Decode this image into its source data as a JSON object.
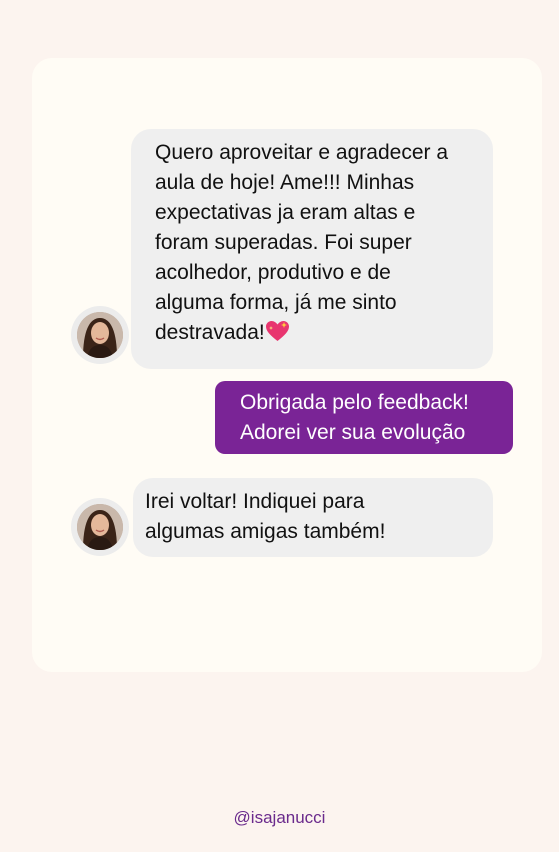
{
  "messages": [
    {
      "sender": "contact",
      "text": "Quero aproveitar e agradecer a\naula de hoje! Ame!!! Minhas\nexpectativas ja eram altas e\nforam superadas. Foi super\nacolhedor, produtivo e de\nalguma forma, já me sinto\ndestravada!",
      "emoji": "sparkling-heart"
    },
    {
      "sender": "me",
      "text": "Obrigada pelo feedback!\nAdorei ver sua evolução"
    },
    {
      "sender": "contact",
      "text": "Irei voltar! Indiquei para\nalgumas amigas também!"
    }
  ],
  "footer": {
    "handle": "@isajanucci"
  },
  "colors": {
    "background": "#fcf4ef",
    "card": "#fffcf5",
    "incoming_bubble": "#efefef",
    "outgoing_bubble": "#7a2496",
    "handle": "#6a2a8c"
  }
}
